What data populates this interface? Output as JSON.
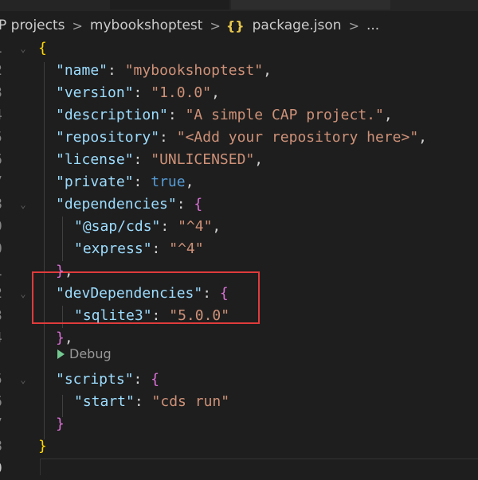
{
  "breadcrumb": {
    "items": [
      "P projects",
      "mybookshoptest",
      "package.json",
      "..."
    ],
    "separator": ">",
    "file_icon": "{}"
  },
  "codelens": {
    "label": "Debug"
  },
  "code": {
    "line_numbers": [
      "1",
      "2",
      "3",
      "4",
      "5",
      "6",
      "7",
      "8",
      "9",
      "0",
      "1",
      "2",
      "3",
      "4",
      "5",
      "6",
      "7",
      "8",
      "9"
    ],
    "lines": [
      [
        {
          "t": "{",
          "c": "br1"
        }
      ],
      [
        {
          "t": "\"name\"",
          "c": "k"
        },
        {
          "t": ": ",
          "c": "p"
        },
        {
          "t": "\"mybookshoptest\"",
          "c": "s"
        },
        {
          "t": ",",
          "c": "p"
        }
      ],
      [
        {
          "t": "\"version\"",
          "c": "k"
        },
        {
          "t": ": ",
          "c": "p"
        },
        {
          "t": "\"1.0.0\"",
          "c": "s"
        },
        {
          "t": ",",
          "c": "p"
        }
      ],
      [
        {
          "t": "\"description\"",
          "c": "k"
        },
        {
          "t": ": ",
          "c": "p"
        },
        {
          "t": "\"A simple CAP project.\"",
          "c": "s"
        },
        {
          "t": ",",
          "c": "p"
        }
      ],
      [
        {
          "t": "\"repository\"",
          "c": "k"
        },
        {
          "t": ": ",
          "c": "p"
        },
        {
          "t": "\"<Add your repository here>\"",
          "c": "s"
        },
        {
          "t": ",",
          "c": "p"
        }
      ],
      [
        {
          "t": "\"license\"",
          "c": "k"
        },
        {
          "t": ": ",
          "c": "p"
        },
        {
          "t": "\"UNLICENSED\"",
          "c": "s"
        },
        {
          "t": ",",
          "c": "p"
        }
      ],
      [
        {
          "t": "\"private\"",
          "c": "k"
        },
        {
          "t": ": ",
          "c": "p"
        },
        {
          "t": "true",
          "c": "b"
        },
        {
          "t": ",",
          "c": "p"
        }
      ],
      [
        {
          "t": "\"dependencies\"",
          "c": "k"
        },
        {
          "t": ": ",
          "c": "p"
        },
        {
          "t": "{",
          "c": "br2"
        }
      ],
      [
        {
          "t": "\"@sap/cds\"",
          "c": "k"
        },
        {
          "t": ": ",
          "c": "p"
        },
        {
          "t": "\"^4\"",
          "c": "s"
        },
        {
          "t": ",",
          "c": "p"
        }
      ],
      [
        {
          "t": "\"express\"",
          "c": "k"
        },
        {
          "t": ": ",
          "c": "p"
        },
        {
          "t": "\"^4\"",
          "c": "s"
        }
      ],
      [
        {
          "t": "}",
          "c": "br2"
        },
        {
          "t": ",",
          "c": "p"
        }
      ],
      [
        {
          "t": "\"devDependencies\"",
          "c": "k"
        },
        {
          "t": ": ",
          "c": "p"
        },
        {
          "t": "{",
          "c": "br2"
        }
      ],
      [
        {
          "t": "\"sqlite3\"",
          "c": "k"
        },
        {
          "t": ": ",
          "c": "p"
        },
        {
          "t": "\"5.0.0\"",
          "c": "s"
        }
      ],
      [
        {
          "t": "}",
          "c": "br2"
        },
        {
          "t": ",",
          "c": "p"
        }
      ],
      [
        {
          "t": "\"scripts\"",
          "c": "k"
        },
        {
          "t": ": ",
          "c": "p"
        },
        {
          "t": "{",
          "c": "br2"
        }
      ],
      [
        {
          "t": "\"start\"",
          "c": "k"
        },
        {
          "t": ": ",
          "c": "p"
        },
        {
          "t": "\"cds run\"",
          "c": "s"
        }
      ],
      [
        {
          "t": "}",
          "c": "br2"
        }
      ],
      [
        {
          "t": "}",
          "c": "br1"
        }
      ],
      []
    ]
  },
  "colors": {
    "background": "#1e1e1e",
    "key": "#9cdcfe",
    "string": "#ce9178",
    "boolean": "#569cd6",
    "highlight_box": "#e03b3b"
  }
}
